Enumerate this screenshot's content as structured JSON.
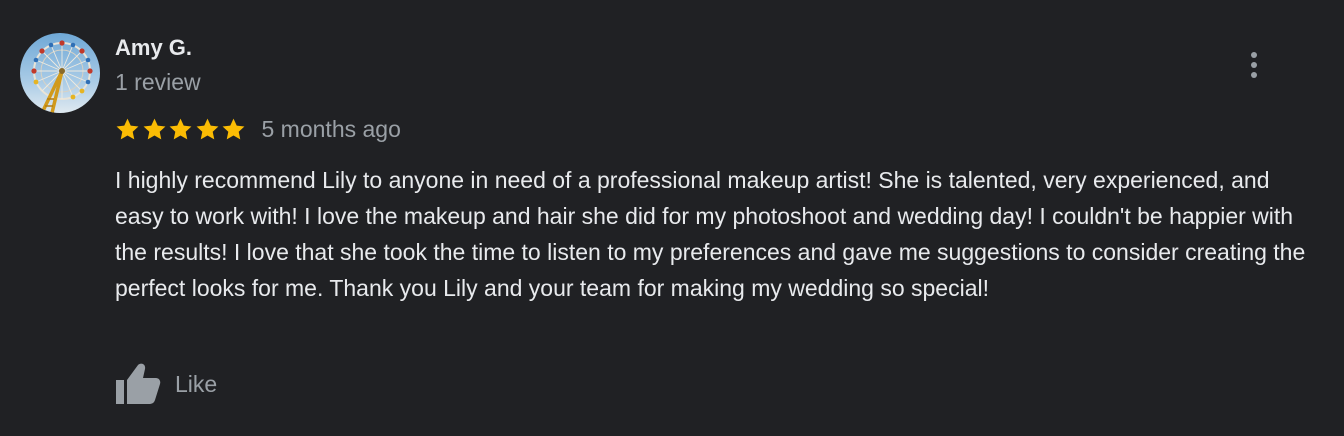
{
  "review": {
    "author_name": "Amy G.",
    "review_count": "1 review",
    "rating": 5,
    "max_rating": 5,
    "date": "5 months ago",
    "text": "I highly recommend Lily to anyone in need of a professional makeup artist! She is talented, very experienced, and easy to work with! I love the makeup and hair she did for my photoshoot and wedding day! I couldn't be happier with the results! I love that she took the time to listen to my preferences and gave me suggestions to consider creating the perfect looks for me. Thank you Lily and your team for making my wedding so special!",
    "like_label": "Like",
    "avatar_icon": "ferris-wheel-photo",
    "more_icon": "more-vert-icon",
    "like_icon": "thumb-up-icon"
  },
  "colors": {
    "background": "#202124",
    "primary_text": "#e8eaed",
    "secondary_text": "#9aa0a6",
    "star": "#fbbc04",
    "icon": "#9aa0a6"
  }
}
